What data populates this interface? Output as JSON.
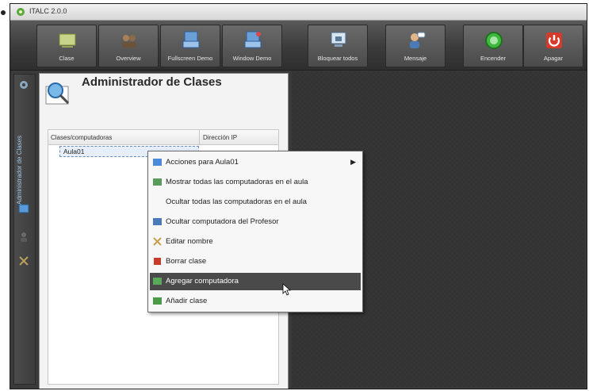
{
  "app": {
    "title": "ITALC 2.0.0"
  },
  "toolbar": {
    "buttons": [
      {
        "label": "Clase",
        "icon": "classroom-icon",
        "color": "#c8d48a"
      },
      {
        "label": "Overview",
        "icon": "overview-icon",
        "color": "#8a6b4a"
      },
      {
        "label": "Fullscreen Demo",
        "icon": "fullscreen-demo-icon",
        "color": "#6a9fd8"
      },
      {
        "label": "Window Demo",
        "icon": "window-demo-icon",
        "color": "#6a9fd8"
      },
      {
        "label": "Bloquear todos",
        "icon": "lock-all-icon",
        "color": "#6aaed8"
      },
      {
        "label": "Mensaje",
        "icon": "message-icon",
        "color": "#6aaed8"
      },
      {
        "label": "Encender",
        "icon": "power-on-icon",
        "color": "#3fb83f"
      },
      {
        "label": "Apagar",
        "icon": "power-off-icon",
        "color": "#d63a2a"
      }
    ]
  },
  "sidebar": {
    "label": "Administrador de Clases"
  },
  "panel": {
    "title": "Administrador de Clases",
    "columns": [
      "Clases/computadoras",
      "Dirección IP"
    ],
    "rows": [
      {
        "name": "Aula01"
      }
    ]
  },
  "context_menu": {
    "items": [
      {
        "label": "Acciones para Aula01",
        "icon": "actions-icon",
        "submenu": true,
        "active": false
      },
      {
        "label": "Mostrar todas las computadoras en el aula",
        "icon": "show-all-icon",
        "active": false
      },
      {
        "label": "Ocultar todas las computadoras en el aula",
        "icon": "",
        "active": false
      },
      {
        "label": "Ocultar computadora del Profesor",
        "icon": "hide-teacher-icon",
        "active": false
      },
      {
        "label": "Editar nombre",
        "icon": "edit-icon",
        "active": false
      },
      {
        "label": "Borrar clase",
        "icon": "delete-icon",
        "active": false
      },
      {
        "label": "Agregar computadora",
        "icon": "add-computer-icon",
        "active": true
      },
      {
        "label": "Añadir clase",
        "icon": "add-class-icon",
        "active": false
      }
    ]
  }
}
